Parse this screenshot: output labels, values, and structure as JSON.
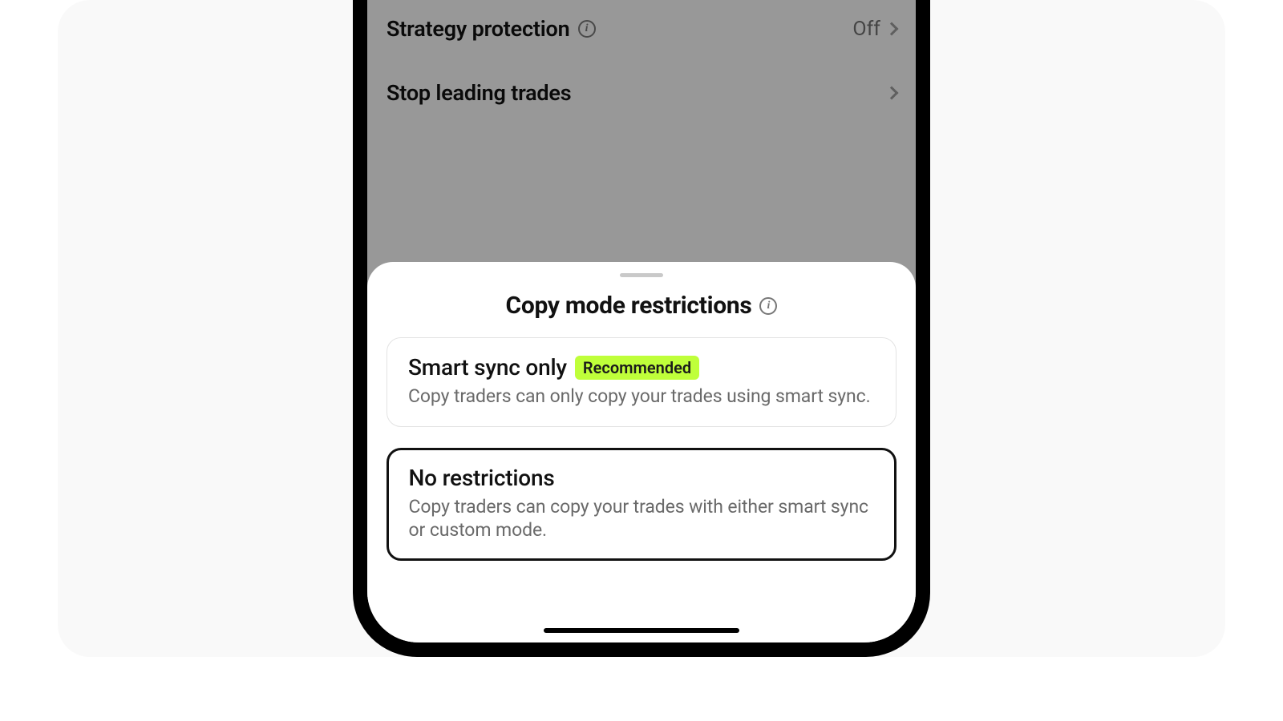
{
  "background_settings": {
    "rows": [
      {
        "title": "Strategy protection",
        "has_info": true,
        "value": "Off"
      },
      {
        "title": "Stop leading trades",
        "has_info": false,
        "value": ""
      }
    ]
  },
  "sheet": {
    "title": "Copy mode restrictions",
    "options": [
      {
        "title": "Smart sync only",
        "badge": "Recommended",
        "desc": "Copy traders can only copy your trades using smart sync.",
        "selected": false
      },
      {
        "title": "No restrictions",
        "badge": "",
        "desc": "Copy traders can copy your trades with either smart sync or custom mode.",
        "selected": true
      }
    ]
  }
}
